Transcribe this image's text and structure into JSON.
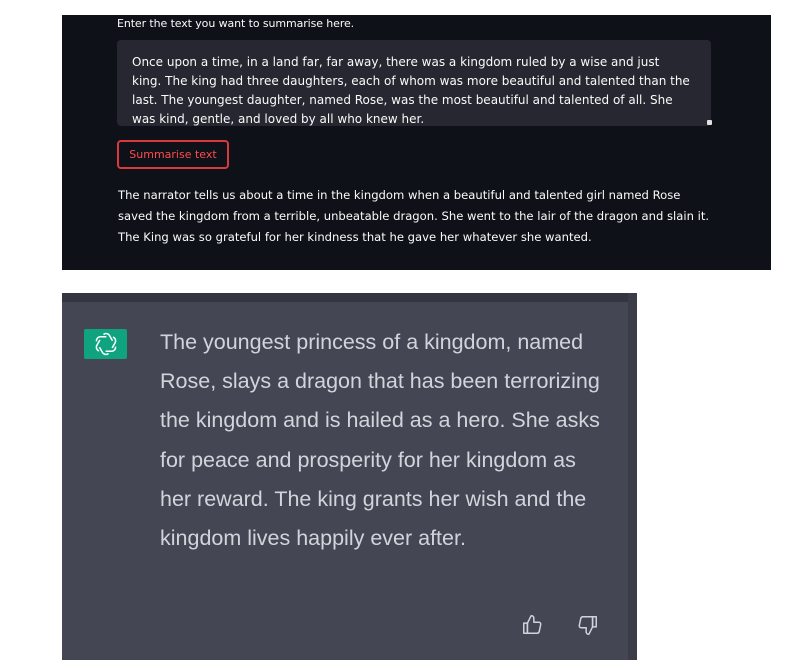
{
  "summariser": {
    "instruction": "Enter the text you want to summarise here.",
    "input_text": "Once upon a time, in a land far, far away, there was a kingdom ruled by a wise and just king. The king had three daughters, each of whom was more beautiful and talented than the last. The youngest daughter, named Rose, was the most beautiful and talented of all. She was kind, gentle, and loved by all who knew her.",
    "button_label": "Summarise text",
    "output_text": "The narrator tells us about a time in the kingdom when a beautiful and talented girl named Rose saved the kingdom from a terrible, unbeatable dragon. She went to the lair of the dragon and slain it. The King was so grateful for her kindness that he gave her whatever she wanted.",
    "colors": {
      "background": "#0e1117",
      "input_background": "#262730",
      "button_border": "#d9393d",
      "button_text": "#ff4b4b",
      "text": "#fafafa"
    }
  },
  "chat": {
    "avatar_icon": "openai-logo-icon",
    "response_text": "The youngest princess of a kingdom, named Rose, slays a dragon that has been terrorizing the kingdom and is hailed as a hero. She asks for peace and prosperity for her kingdom as her reward. The king grants her wish and the kingdom lives happily ever after.",
    "feedback_icons": [
      "thumbs-up-icon",
      "thumbs-down-icon"
    ],
    "colors": {
      "background": "#444654",
      "avatar_background": "#10a37f",
      "text": "#d1d5db"
    }
  }
}
